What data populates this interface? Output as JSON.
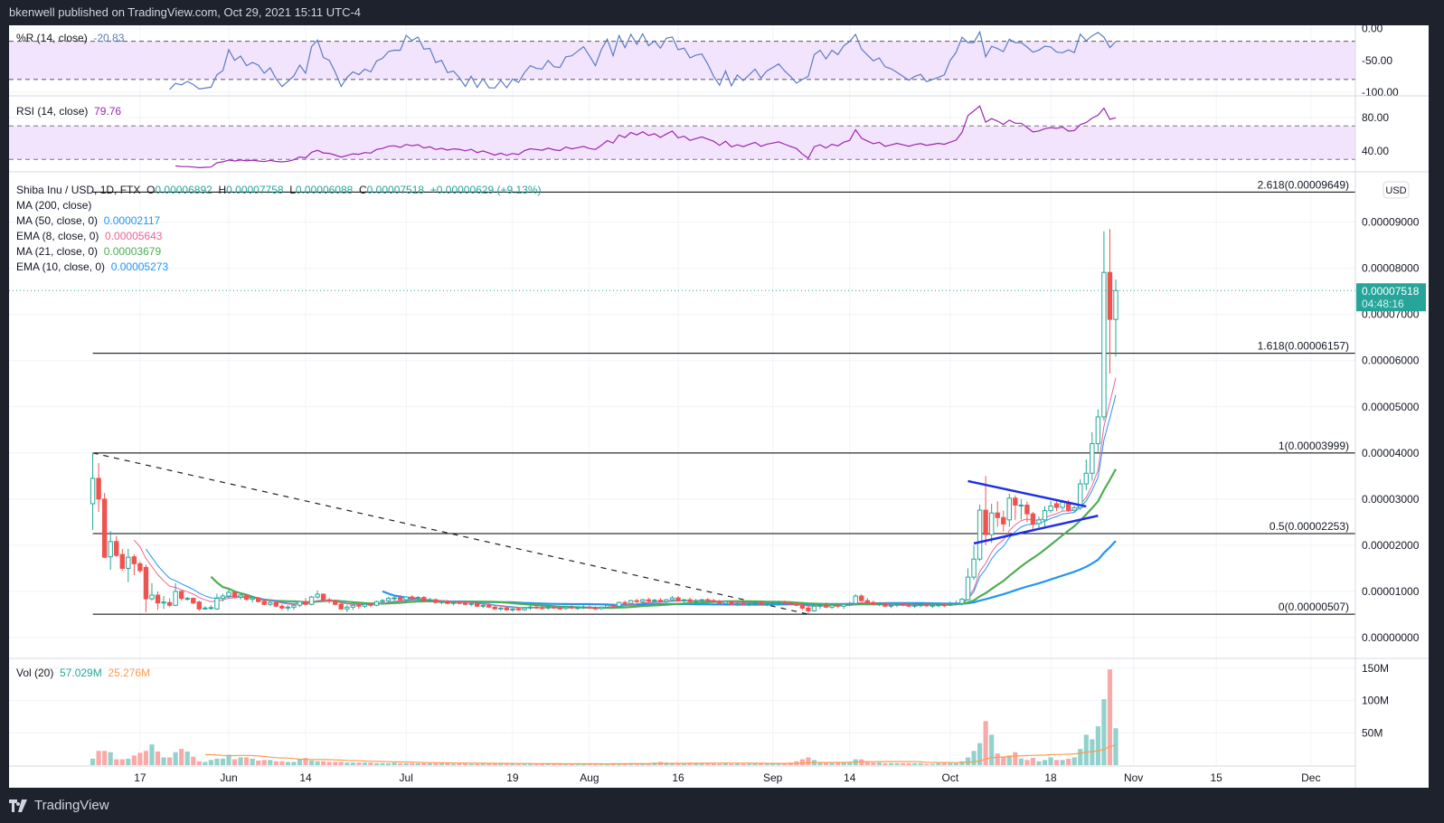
{
  "header": {
    "published": "bkenwell published on TradingView.com, Oct 29, 2021 15:11 UTC-4"
  },
  "footer": {
    "brand": "TradingView",
    "logo_icon": "tradingview-logo-icon"
  },
  "colors": {
    "up": "#26a69a",
    "down": "#ef5350",
    "vol_up": "#93d2cc",
    "vol_down": "#f8aaa8",
    "vol_ma": "#ff9a4d",
    "ma50": "#2196f3",
    "ema8": "#f06292",
    "ma21": "#4caf50",
    "ema10": "#2196f3",
    "wr": "#5b7cc4",
    "rsi": "#9c27b0",
    "band": "#f3e4fd",
    "fib": "#000000",
    "trend": "#1e2fe6"
  },
  "legend": {
    "symbol": "Shiba Inu / USD, 1D, FTX",
    "o_label": "O",
    "o": "0.00006892",
    "h_label": "H",
    "h": "0.00007758",
    "l_label": "L",
    "l": "0.00006088",
    "c_label": "C",
    "c": "0.00007518",
    "change": "+0.00000629 (+9.13%)",
    "ma200": "MA (200, close)",
    "ma50_label": "MA (50, close, 0)",
    "ma50": "0.00002117",
    "ema8_label": "EMA (8, close, 0)",
    "ema8": "0.00005643",
    "ma21_label": "MA (21, close, 0)",
    "ma21": "0.00003679",
    "ema10_label": "EMA (10, close, 0)",
    "ema10": "0.00005273",
    "wr_label": "%R (14, close)",
    "wr": "-20.83",
    "rsi_label": "RSI (14, close)",
    "rsi": "79.76",
    "vol_label": "Vol (20)",
    "vol": "57.029M",
    "vol_ma": "25.276M"
  },
  "price_axis": {
    "currency": "USD",
    "last_price": "0.00007518",
    "countdown": "04:48:16"
  },
  "chart_data": {
    "type": "candlestick",
    "title": "Shiba Inu / USD, 1D, FTX",
    "unit": "1e-5 USD",
    "start_date": "2021-05-09",
    "ohlc": [
      [
        2.9,
        3.99,
        2.33,
        3.45
      ],
      [
        3.45,
        3.78,
        2.72,
        3.0
      ],
      [
        3.0,
        3.13,
        1.72,
        1.74
      ],
      [
        1.75,
        2.31,
        1.47,
        2.08
      ],
      [
        2.08,
        2.2,
        1.75,
        1.78
      ],
      [
        1.8,
        1.92,
        1.45,
        1.5
      ],
      [
        1.5,
        1.92,
        1.2,
        1.74
      ],
      [
        1.75,
        1.8,
        1.35,
        1.6
      ],
      [
        1.6,
        1.65,
        1.4,
        1.45
      ],
      [
        1.52,
        1.58,
        0.55,
        0.84
      ],
      [
        0.84,
        1.18,
        0.8,
        0.92
      ],
      [
        0.92,
        1.0,
        0.6,
        0.75
      ],
      [
        0.75,
        0.9,
        0.62,
        0.77
      ],
      [
        0.76,
        0.85,
        0.66,
        0.7
      ],
      [
        0.7,
        1.18,
        0.68,
        1.0
      ],
      [
        1.0,
        1.03,
        0.8,
        0.85
      ],
      [
        0.85,
        0.88,
        0.8,
        0.85
      ],
      [
        0.85,
        0.87,
        0.72,
        0.75
      ],
      [
        0.77,
        0.8,
        0.58,
        0.62
      ],
      [
        0.64,
        0.68,
        0.6,
        0.64
      ],
      [
        0.64,
        0.7,
        0.6,
        0.65
      ],
      [
        0.62,
        0.95,
        0.6,
        0.85
      ],
      [
        0.85,
        0.95,
        0.78,
        0.9
      ],
      [
        0.9,
        1.05,
        0.85,
        0.98
      ],
      [
        0.98,
        1.0,
        0.86,
        0.88
      ],
      [
        0.88,
        0.95,
        0.82,
        0.92
      ],
      [
        0.92,
        0.94,
        0.8,
        0.83
      ],
      [
        0.83,
        0.9,
        0.76,
        0.86
      ],
      [
        0.86,
        0.88,
        0.76,
        0.78
      ],
      [
        0.78,
        0.82,
        0.7,
        0.72
      ],
      [
        0.72,
        0.8,
        0.68,
        0.76
      ],
      [
        0.76,
        0.78,
        0.66,
        0.68
      ],
      [
        0.68,
        0.72,
        0.6,
        0.64
      ],
      [
        0.64,
        0.7,
        0.58,
        0.66
      ],
      [
        0.66,
        0.72,
        0.6,
        0.7
      ],
      [
        0.7,
        0.8,
        0.66,
        0.78
      ],
      [
        0.78,
        0.86,
        0.7,
        0.72
      ],
      [
        0.72,
        0.9,
        0.7,
        0.88
      ],
      [
        0.88,
        1.02,
        0.84,
        0.94
      ],
      [
        0.94,
        0.96,
        0.8,
        0.82
      ],
      [
        0.82,
        0.86,
        0.74,
        0.8
      ],
      [
        0.8,
        0.82,
        0.7,
        0.72
      ],
      [
        0.72,
        0.76,
        0.6,
        0.62
      ],
      [
        0.62,
        0.7,
        0.55,
        0.66
      ],
      [
        0.66,
        0.72,
        0.6,
        0.7
      ],
      [
        0.7,
        0.74,
        0.62,
        0.68
      ],
      [
        0.68,
        0.75,
        0.64,
        0.72
      ],
      [
        0.72,
        0.76,
        0.66,
        0.7
      ],
      [
        0.7,
        0.8,
        0.68,
        0.78
      ],
      [
        0.78,
        0.84,
        0.72,
        0.8
      ],
      [
        0.8,
        0.88,
        0.76,
        0.85
      ],
      [
        0.85,
        0.9,
        0.8,
        0.86
      ],
      [
        0.86,
        0.92,
        0.78,
        0.82
      ],
      [
        0.82,
        0.9,
        0.78,
        0.88
      ],
      [
        0.88,
        0.92,
        0.82,
        0.85
      ],
      [
        0.85,
        0.9,
        0.8,
        0.87
      ],
      [
        0.87,
        0.9,
        0.78,
        0.8
      ],
      [
        0.8,
        0.86,
        0.76,
        0.82
      ],
      [
        0.82,
        0.85,
        0.74,
        0.76
      ],
      [
        0.76,
        0.8,
        0.72,
        0.78
      ],
      [
        0.78,
        0.82,
        0.72,
        0.74
      ],
      [
        0.74,
        0.78,
        0.7,
        0.76
      ],
      [
        0.76,
        0.8,
        0.72,
        0.75
      ],
      [
        0.75,
        0.78,
        0.7,
        0.72
      ],
      [
        0.72,
        0.76,
        0.68,
        0.74
      ],
      [
        0.74,
        0.76,
        0.66,
        0.68
      ],
      [
        0.68,
        0.72,
        0.64,
        0.7
      ],
      [
        0.7,
        0.74,
        0.64,
        0.66
      ],
      [
        0.66,
        0.7,
        0.6,
        0.62
      ],
      [
        0.62,
        0.66,
        0.58,
        0.64
      ],
      [
        0.64,
        0.66,
        0.58,
        0.6
      ],
      [
        0.6,
        0.64,
        0.56,
        0.62
      ],
      [
        0.62,
        0.66,
        0.58,
        0.6
      ],
      [
        0.6,
        0.66,
        0.58,
        0.64
      ],
      [
        0.64,
        0.7,
        0.6,
        0.66
      ],
      [
        0.66,
        0.7,
        0.62,
        0.65
      ],
      [
        0.65,
        0.68,
        0.6,
        0.64
      ],
      [
        0.64,
        0.68,
        0.6,
        0.66
      ],
      [
        0.66,
        0.7,
        0.62,
        0.64
      ],
      [
        0.64,
        0.68,
        0.6,
        0.63
      ],
      [
        0.63,
        0.68,
        0.6,
        0.66
      ],
      [
        0.66,
        0.7,
        0.62,
        0.64
      ],
      [
        0.64,
        0.68,
        0.6,
        0.65
      ],
      [
        0.65,
        0.7,
        0.62,
        0.66
      ],
      [
        0.66,
        0.7,
        0.62,
        0.64
      ],
      [
        0.64,
        0.68,
        0.6,
        0.63
      ],
      [
        0.63,
        0.68,
        0.6,
        0.66
      ],
      [
        0.66,
        0.72,
        0.64,
        0.7
      ],
      [
        0.7,
        0.74,
        0.64,
        0.68
      ],
      [
        0.68,
        0.78,
        0.66,
        0.76
      ],
      [
        0.76,
        0.8,
        0.7,
        0.74
      ],
      [
        0.74,
        0.82,
        0.72,
        0.8
      ],
      [
        0.8,
        0.84,
        0.74,
        0.78
      ],
      [
        0.78,
        0.84,
        0.74,
        0.82
      ],
      [
        0.82,
        0.86,
        0.76,
        0.79
      ],
      [
        0.79,
        0.84,
        0.76,
        0.81
      ],
      [
        0.81,
        0.86,
        0.76,
        0.78
      ],
      [
        0.78,
        0.84,
        0.74,
        0.82
      ],
      [
        0.82,
        0.9,
        0.8,
        0.86
      ],
      [
        0.86,
        0.9,
        0.78,
        0.8
      ],
      [
        0.8,
        0.84,
        0.76,
        0.82
      ],
      [
        0.82,
        0.86,
        0.76,
        0.78
      ],
      [
        0.78,
        0.84,
        0.74,
        0.8
      ],
      [
        0.8,
        0.84,
        0.76,
        0.82
      ],
      [
        0.82,
        0.86,
        0.78,
        0.8
      ],
      [
        0.8,
        0.84,
        0.76,
        0.78
      ],
      [
        0.78,
        0.82,
        0.72,
        0.74
      ],
      [
        0.74,
        0.8,
        0.72,
        0.78
      ],
      [
        0.78,
        0.8,
        0.7,
        0.72
      ],
      [
        0.72,
        0.76,
        0.68,
        0.74
      ],
      [
        0.74,
        0.78,
        0.7,
        0.72
      ],
      [
        0.72,
        0.76,
        0.68,
        0.74
      ],
      [
        0.74,
        0.8,
        0.7,
        0.76
      ],
      [
        0.76,
        0.78,
        0.7,
        0.72
      ],
      [
        0.72,
        0.76,
        0.68,
        0.74
      ],
      [
        0.74,
        0.78,
        0.7,
        0.75
      ],
      [
        0.75,
        0.8,
        0.72,
        0.76
      ],
      [
        0.76,
        0.8,
        0.72,
        0.74
      ],
      [
        0.74,
        0.78,
        0.7,
        0.72
      ],
      [
        0.72,
        0.76,
        0.68,
        0.7
      ],
      [
        0.7,
        0.72,
        0.6,
        0.64
      ],
      [
        0.64,
        0.68,
        0.507,
        0.58
      ],
      [
        0.58,
        0.72,
        0.56,
        0.68
      ],
      [
        0.68,
        0.74,
        0.62,
        0.7
      ],
      [
        0.7,
        0.76,
        0.64,
        0.66
      ],
      [
        0.66,
        0.72,
        0.62,
        0.7
      ],
      [
        0.7,
        0.74,
        0.64,
        0.68
      ],
      [
        0.68,
        0.74,
        0.62,
        0.72
      ],
      [
        0.72,
        0.78,
        0.68,
        0.74
      ],
      [
        0.74,
        0.94,
        0.72,
        0.9
      ],
      [
        0.9,
        0.94,
        0.78,
        0.8
      ],
      [
        0.8,
        0.86,
        0.74,
        0.76
      ],
      [
        0.76,
        0.8,
        0.7,
        0.72
      ],
      [
        0.72,
        0.76,
        0.68,
        0.74
      ],
      [
        0.74,
        0.76,
        0.66,
        0.68
      ],
      [
        0.68,
        0.72,
        0.64,
        0.7
      ],
      [
        0.7,
        0.74,
        0.66,
        0.72
      ],
      [
        0.72,
        0.76,
        0.68,
        0.7
      ],
      [
        0.7,
        0.74,
        0.66,
        0.68
      ],
      [
        0.68,
        0.72,
        0.64,
        0.7
      ],
      [
        0.7,
        0.74,
        0.66,
        0.71
      ],
      [
        0.71,
        0.74,
        0.66,
        0.69
      ],
      [
        0.69,
        0.72,
        0.64,
        0.7
      ],
      [
        0.7,
        0.74,
        0.66,
        0.71
      ],
      [
        0.71,
        0.74,
        0.66,
        0.7
      ],
      [
        0.7,
        0.78,
        0.68,
        0.72
      ],
      [
        0.72,
        0.8,
        0.7,
        0.74
      ],
      [
        0.74,
        0.86,
        0.7,
        0.83
      ],
      [
        0.82,
        1.5,
        0.8,
        1.31
      ],
      [
        1.31,
        2.0,
        1.25,
        1.7
      ],
      [
        1.7,
        2.88,
        1.66,
        2.76
      ],
      [
        2.76,
        3.5,
        2.0,
        2.23
      ],
      [
        2.23,
        2.9,
        2.05,
        2.7
      ],
      [
        2.7,
        2.95,
        2.4,
        2.6
      ],
      [
        2.6,
        2.75,
        2.3,
        2.46
      ],
      [
        2.55,
        3.12,
        2.4,
        3.02
      ],
      [
        3.02,
        3.08,
        2.55,
        2.87
      ],
      [
        2.87,
        3.0,
        2.56,
        2.87
      ],
      [
        2.87,
        2.95,
        2.5,
        2.68
      ],
      [
        2.68,
        2.72,
        2.3,
        2.46
      ],
      [
        2.47,
        2.62,
        2.38,
        2.55
      ],
      [
        2.55,
        2.85,
        2.4,
        2.75
      ],
      [
        2.75,
        2.96,
        2.7,
        2.85
      ],
      [
        2.9,
        2.95,
        2.74,
        2.82
      ],
      [
        2.82,
        2.98,
        2.75,
        2.93
      ],
      [
        2.93,
        2.98,
        2.72,
        2.76
      ],
      [
        2.76,
        2.85,
        2.72,
        2.81
      ],
      [
        2.81,
        3.43,
        2.76,
        3.33
      ],
      [
        3.33,
        3.86,
        3.2,
        3.56
      ],
      [
        3.56,
        4.45,
        3.4,
        4.2
      ],
      [
        4.2,
        4.94,
        4.0,
        4.78
      ],
      [
        4.78,
        8.8,
        4.7,
        7.91
      ],
      [
        7.91,
        8.85,
        5.72,
        6.892
      ],
      [
        6.892,
        7.758,
        6.088,
        7.518
      ]
    ],
    "volume_m": [
      10,
      22,
      22,
      20,
      9,
      9,
      10,
      15,
      19,
      22,
      32,
      21,
      12,
      12,
      20,
      25,
      21,
      13,
      6,
      5,
      8,
      10,
      10,
      16,
      9,
      12,
      12,
      10,
      7,
      8,
      8,
      6,
      6,
      5,
      5,
      9,
      11,
      7,
      6,
      6,
      5,
      5,
      5,
      4,
      4,
      4,
      4,
      4,
      3,
      3,
      3,
      4,
      3,
      3,
      3,
      3,
      3,
      3,
      3,
      3,
      3,
      2,
      3,
      3,
      2,
      2,
      2,
      3,
      2,
      2,
      2,
      2,
      2,
      2,
      2,
      2,
      2,
      2,
      2,
      2,
      2,
      2,
      2,
      2,
      2,
      2,
      2,
      2,
      3,
      3,
      3,
      3,
      3,
      3,
      3,
      4,
      5,
      4,
      3,
      3,
      3,
      3,
      3,
      3,
      3,
      3,
      2,
      3,
      2,
      3,
      2,
      2,
      2,
      2,
      2,
      3,
      3,
      3,
      4,
      6,
      9,
      12,
      8,
      5,
      4,
      4,
      4,
      5,
      5,
      9,
      9,
      6,
      4,
      4,
      3,
      3,
      3,
      3,
      3,
      3,
      3,
      2,
      2,
      3,
      3,
      3,
      3,
      6,
      12,
      22,
      34,
      68,
      47,
      18,
      12,
      15,
      20,
      10,
      8,
      11,
      6,
      8,
      12,
      8,
      8,
      10,
      12,
      25,
      47,
      40,
      60,
      102,
      148,
      57.029
    ],
    "price_ticks": [
      {
        "v": 9,
        "label": "0.00009000"
      },
      {
        "v": 8,
        "label": "0.00008000"
      },
      {
        "v": 7,
        "label": "0.00007000"
      },
      {
        "v": 6,
        "label": "0.00006000"
      },
      {
        "v": 5,
        "label": "0.00005000"
      },
      {
        "v": 4,
        "label": "0.00004000"
      },
      {
        "v": 3,
        "label": "0.00003000"
      },
      {
        "v": 2,
        "label": "0.00002000"
      },
      {
        "v": 1,
        "label": "0.00001000"
      },
      {
        "v": 0,
        "label": "0.00000000"
      }
    ],
    "wr_ticks": [
      {
        "v": 0,
        "label": "0.00"
      },
      {
        "v": -50,
        "label": "-50.00"
      },
      {
        "v": -100,
        "label": "-100.00"
      }
    ],
    "wr_bands": [
      -20,
      -80
    ],
    "rsi_ticks": [
      {
        "v": 80,
        "label": "80.00"
      },
      {
        "v": 40,
        "label": "40.00"
      }
    ],
    "rsi_bands": [
      70,
      30
    ],
    "vol_ticks": [
      {
        "v": 150,
        "label": "150M"
      },
      {
        "v": 100,
        "label": "100M"
      },
      {
        "v": 50,
        "label": "50M"
      }
    ],
    "time_ticks": [
      {
        "label": "17",
        "date": "2021-05-17"
      },
      {
        "label": "Jun",
        "date": "2021-06-01"
      },
      {
        "label": "14",
        "date": "2021-06-14"
      },
      {
        "label": "Jul",
        "date": "2021-07-01"
      },
      {
        "label": "19",
        "date": "2021-07-19"
      },
      {
        "label": "Aug",
        "date": "2021-08-01"
      },
      {
        "label": "16",
        "date": "2021-08-16"
      },
      {
        "label": "Sep",
        "date": "2021-09-01"
      },
      {
        "label": "14",
        "date": "2021-09-14"
      },
      {
        "label": "Oct",
        "date": "2021-10-01"
      },
      {
        "label": "18",
        "date": "2021-10-18"
      },
      {
        "label": "Nov",
        "date": "2021-11-01"
      },
      {
        "label": "15",
        "date": "2021-11-15"
      },
      {
        "label": "Dec",
        "date": "2021-12-01"
      }
    ],
    "fib_levels": [
      {
        "v": 9.649,
        "label": "2.618(0.00009649)"
      },
      {
        "v": 6.157,
        "label": "1.618(0.00006157)"
      },
      {
        "v": 3.999,
        "label": "1(0.00003999)"
      },
      {
        "v": 2.253,
        "label": "0.5(0.00002253)"
      },
      {
        "v": 0.507,
        "label": "0(0.00000507)"
      }
    ],
    "dashed_trendline": {
      "from": {
        "date": "2021-05-09",
        "v": 3.999
      },
      "to": {
        "date": "2021-09-07",
        "v": 0.507
      }
    },
    "triangle_lines": [
      {
        "from": {
          "date": "2021-10-04",
          "v": 3.39
        },
        "to": {
          "date": "2021-10-24",
          "v": 2.84
        }
      },
      {
        "from": {
          "date": "2021-10-05",
          "v": 2.04
        },
        "to": {
          "date": "2021-10-26",
          "v": 2.64
        }
      }
    ]
  }
}
